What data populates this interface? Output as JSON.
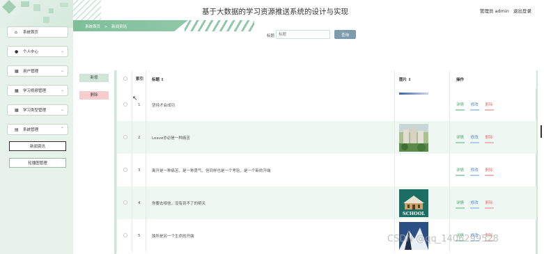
{
  "header": {
    "title": "基于大数据的学习资源推送系统的设计与实现",
    "user_label": "管理员 admin",
    "logout_label": "退出登录"
  },
  "breadcrumb": {
    "home": "系统首页",
    "separator": ">",
    "current": "新闻资讯"
  },
  "sidebar": {
    "items": [
      {
        "label": "系统首页",
        "icon": "home-icon",
        "glyph": "⌂"
      },
      {
        "label": "个人中心",
        "icon": "user-icon",
        "glyph": "●"
      },
      {
        "label": "用户管理",
        "icon": "grid-icon",
        "glyph": "▦"
      },
      {
        "label": "学习视频管理",
        "icon": "grid-icon",
        "glyph": "▦"
      },
      {
        "label": "学习类型管理",
        "icon": "grid-icon",
        "glyph": "▦"
      },
      {
        "label": "系统管理",
        "icon": "document-icon",
        "glyph": "▤"
      }
    ],
    "sub_items": [
      {
        "label": "新闻资讯"
      },
      {
        "label": "轮播图管理"
      }
    ]
  },
  "search": {
    "label": "标题",
    "placeholder": "标题",
    "button_label": "查询"
  },
  "actions": {
    "add_label": "新增",
    "delete_label": "删除"
  },
  "table": {
    "headers": {
      "index": "索引",
      "title": "标题 ⇕",
      "image": "图片 ⇕",
      "operations": "操作"
    },
    "rows": [
      {
        "index": "1",
        "title": "坚持才会成功"
      },
      {
        "index": "2",
        "title": "Leave亦必是一种痛苦"
      },
      {
        "index": "3",
        "title": "离开是一种痛苦，是一种勇气，但同样也是一个考验，是一个新的开端"
      },
      {
        "index": "4",
        "title": "你要去相信，没有到不了的明天"
      },
      {
        "index": "5",
        "title": "独所是另一个生命的开端"
      }
    ],
    "op_labels": {
      "detail": "详情",
      "edit": "修改",
      "remove": "删除"
    },
    "school_sign": "SCHOOL"
  },
  "watermark": "CSDN @qq_1406299528",
  "colors": {
    "accent": "#7fbe9a",
    "sidebar_bg": "#e6f2ea",
    "search_button": "#7d9cad",
    "add_button": "#cfe6d8",
    "delete_button": "#f7cccc"
  }
}
